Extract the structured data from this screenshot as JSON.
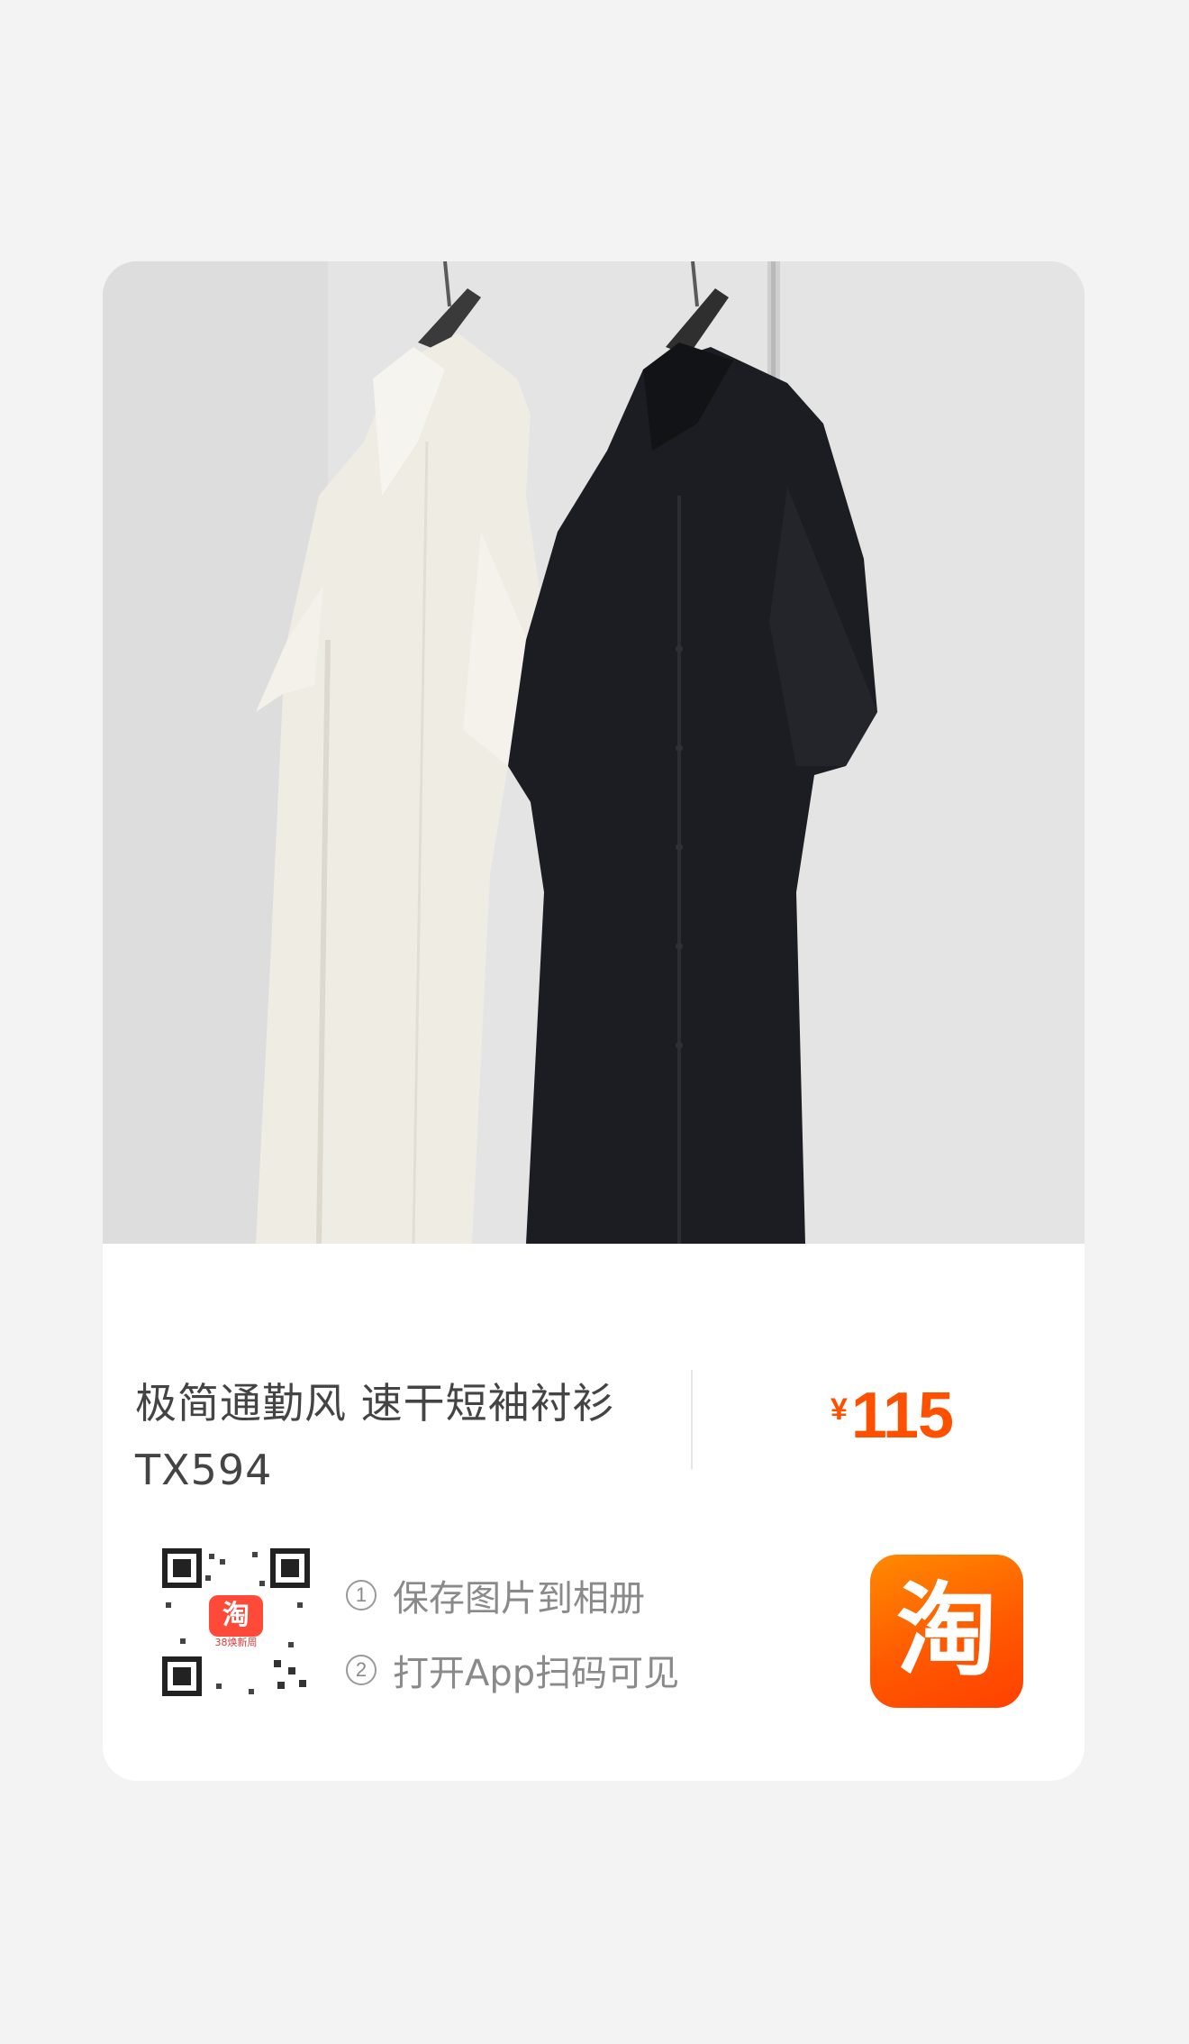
{
  "product": {
    "title_line1": "极简通勤风 速干短袖衬衫",
    "title_line2": "TX594",
    "currency": "¥",
    "price": "115"
  },
  "share": {
    "step1_num": "1",
    "step1_text": "保存图片到相册",
    "step2_num": "2",
    "step2_text": "打开App扫码可见",
    "qr_logo_text": "淘",
    "qr_caption": "38焕新周"
  },
  "brand": {
    "logo_text": "淘",
    "color": "#ff5000"
  },
  "image": {
    "subject_icon": "shirts-on-hangers-photo"
  }
}
